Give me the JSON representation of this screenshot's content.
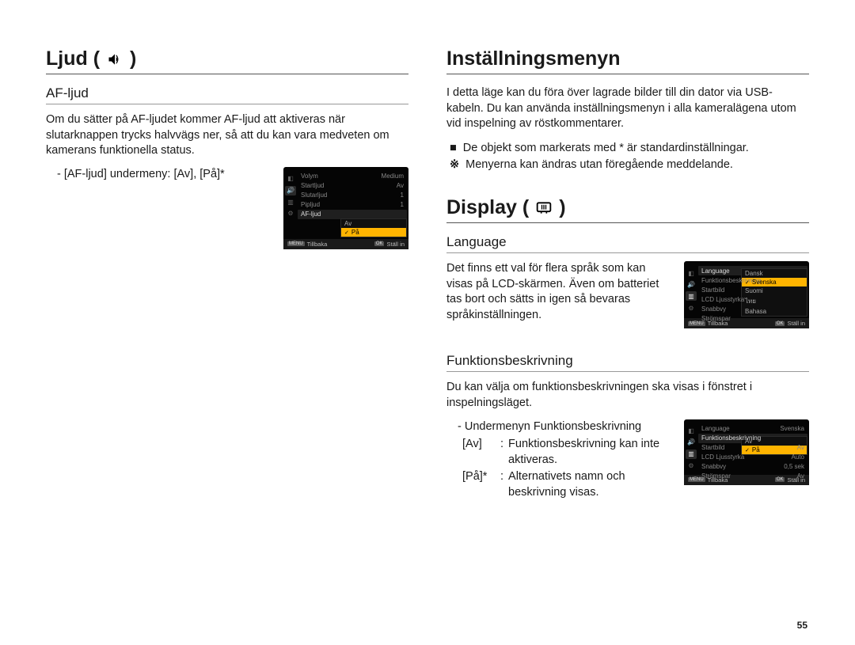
{
  "left": {
    "h1": "Ljud (",
    "h1_close": " )",
    "af": {
      "heading": "AF-ljud",
      "para": "Om du sätter på AF-ljudet kommer AF-ljud att aktiveras när slutarknappen trycks halvvägs ner, så att du kan vara medveten om kamerans funktionella status.",
      "sub": "- [AF-ljud] undermeny: [Av], [På]*"
    },
    "shot": {
      "rows": [
        {
          "k": "Volym",
          "v": "Medium"
        },
        {
          "k": "Startljud",
          "v": "Av"
        },
        {
          "k": "Slutarljud",
          "v": "1"
        },
        {
          "k": "Pipljud",
          "v": "1"
        },
        {
          "k": "AF-ljud",
          "v": ""
        }
      ],
      "opts": [
        {
          "t": "Av",
          "hi": false
        },
        {
          "t": "På",
          "hi": true,
          "ck": true
        }
      ],
      "back": "Tillbaka",
      "ok": "Ställ in"
    }
  },
  "right": {
    "settings": {
      "h1": "Inställningsmenyn",
      "para": "I detta läge kan du föra över lagrade bilder till din dator via USB-kabeln. Du kan använda inställningsmenyn i alla kameralägena utom vid inspelning av röstkommentarer.",
      "b1": "De objekt som markerats med * är standardinställningar.",
      "b2": "Menyerna kan ändras utan föregående meddelande."
    },
    "display": {
      "h1_open": "Display (",
      "h1_close": " )"
    },
    "language": {
      "heading": "Language",
      "para": "Det finns ett val för flera språk som kan visas på LCD-skärmen. Även om batteriet tas bort och sätts in igen så bevaras språkinställningen.",
      "shot": {
        "rows": [
          {
            "k": "Language",
            "v": ""
          },
          {
            "k": "Funktionsbeskrivning",
            "v": ""
          },
          {
            "k": "Startbild",
            "v": ""
          },
          {
            "k": "LCD Ljusstyrka",
            "v": ""
          },
          {
            "k": "Snabbvy",
            "v": ""
          },
          {
            "k": "Strömspar",
            "v": ""
          }
        ],
        "opts": [
          {
            "t": "Dansk"
          },
          {
            "t": "Svenska",
            "hi": true,
            "ck": true
          },
          {
            "t": "Suomi"
          },
          {
            "t": "ไทย"
          },
          {
            "t": "Bahasa"
          }
        ],
        "back": "Tillbaka",
        "ok": "Ställ in"
      }
    },
    "func": {
      "heading": "Funktionsbeskrivning",
      "para": "Du kan välja om funktionsbeskrivningen ska visas i fönstret i inspelningsläget.",
      "subhead": "- Undermenyn Funktionsbeskrivning",
      "defs": [
        {
          "lbl": "[Av]",
          "sep": ":",
          "txt": "Funktionsbeskrivning kan inte aktiveras."
        },
        {
          "lbl": "[På]*",
          "sep": ":",
          "txt": "Alternativets namn och beskrivning visas."
        }
      ],
      "shot": {
        "rows": [
          {
            "k": "Language",
            "v": "Svenska"
          },
          {
            "k": "Funktionsbeskrivning",
            "v": "",
            "sel": true
          },
          {
            "k": "Startbild",
            "v": "Av"
          },
          {
            "k": "LCD Ljusstyrka",
            "v": "Auto"
          },
          {
            "k": "Snabbvy",
            "v": "0,5 sek"
          },
          {
            "k": "Strömspar",
            "v": "Av"
          }
        ],
        "opts": [
          {
            "t": "Av"
          },
          {
            "t": "På",
            "hi": true,
            "ck": true
          }
        ],
        "back": "Tillbaka",
        "ok": "Ställ in"
      }
    }
  },
  "pagenum": "55",
  "menu_btn": "MENU",
  "ok_btn": "OK"
}
